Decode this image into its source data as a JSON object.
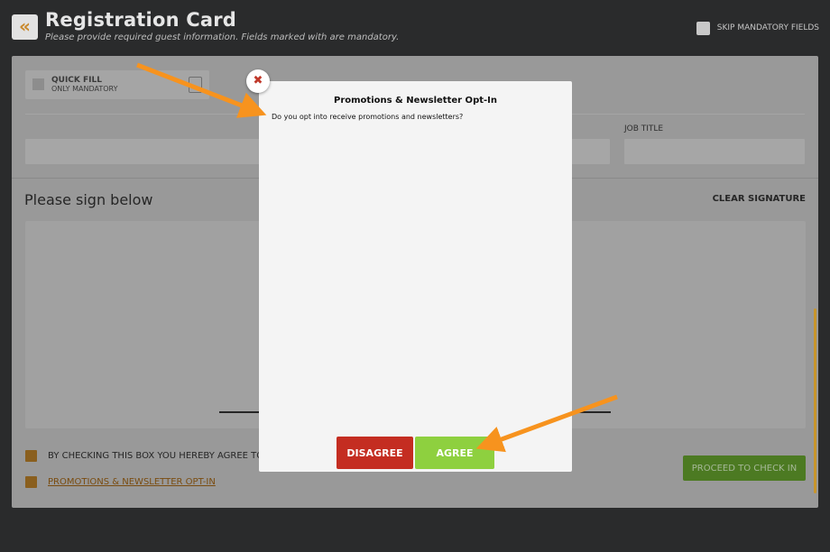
{
  "header": {
    "back_icon": "double-chevron-left-icon",
    "title": "Registration Card",
    "subtitle": "Please provide required guest information. Fields marked with  are mandatory.",
    "skip_label": "SKIP MANDATORY FIELDS"
  },
  "quick_fill": {
    "title": "QUICK FILL",
    "subtitle": "ONLY MANDATORY",
    "icon": "document-icon"
  },
  "fields": {
    "job_title_label": "JOB TITLE"
  },
  "signature": {
    "title": "Please sign below",
    "clear_label": "CLEAR SIGNATURE"
  },
  "agreements": {
    "terms_text": "BY CHECKING THIS BOX YOU HEREBY AGREE TO T",
    "promo_link": "PROMOTIONS & NEWSLETTER OPT-IN"
  },
  "proceed_label": "PROCEED TO CHECK IN",
  "modal": {
    "title": "Promotions & Newsletter Opt-In",
    "message": "Do you opt into receive promotions and newsletters?",
    "close_icon": "close-icon",
    "disagree_label": "DISAGREE",
    "agree_label": "AGREE"
  },
  "colors": {
    "accent_orange": "#c9892c",
    "disagree_red": "#c42d21",
    "agree_green": "#8ed03f",
    "proceed_green": "#4c7a22",
    "annotation_arrow": "#f7931e"
  }
}
